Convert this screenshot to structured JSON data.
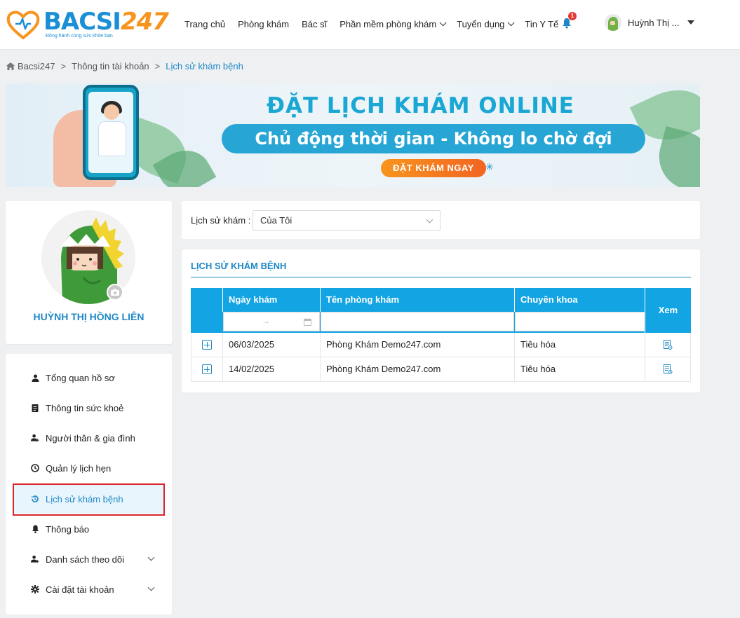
{
  "header": {
    "logo": {
      "brand_main": "BACSI",
      "brand_num": "247",
      "tagline": "Đồng hành cùng sức khỏe bạn"
    },
    "nav": [
      {
        "label": "Trang chủ",
        "dropdown": false
      },
      {
        "label": "Phòng khám",
        "dropdown": false
      },
      {
        "label": "Bác sĩ",
        "dropdown": false
      },
      {
        "label": "Phần mềm phòng khám",
        "dropdown": true
      },
      {
        "label": "Tuyển dụng",
        "dropdown": true
      },
      {
        "label": "Tin Y Tế",
        "dropdown": false
      }
    ],
    "notification_count": "1",
    "user_name": "Huỳnh Thị ..."
  },
  "breadcrumb": [
    "Bacsi247",
    "Thông tin tài khoản",
    "Lịch sử khám bệnh"
  ],
  "banner": {
    "title": "ĐẶT LỊCH KHÁM ONLINE",
    "subtitle": "Chủ động thời gian - Không lo chờ đợi",
    "cta": "ĐẶT KHÁM NGAY"
  },
  "profile": {
    "name": "HUỲNH THỊ HỒNG LIÊN"
  },
  "menu": [
    {
      "label": "Tổng quan hồ sơ",
      "icon": "user-icon"
    },
    {
      "label": "Thông tin sức khoẻ",
      "icon": "clipboard-icon"
    },
    {
      "label": "Người thân & gia đình",
      "icon": "user-plus-icon"
    },
    {
      "label": "Quản lý lịch hẹn",
      "icon": "clock-icon"
    },
    {
      "label": "Lịch sử khám bệnh",
      "icon": "history-icon",
      "active": true
    },
    {
      "label": "Thông báo",
      "icon": "bell-icon"
    },
    {
      "label": "Danh sách theo dõi",
      "icon": "user-follow-icon",
      "expandable": true
    },
    {
      "label": "Cài đặt tài khoản",
      "icon": "gear-icon",
      "expandable": true
    }
  ],
  "filter": {
    "label": "Lịch sử khám",
    "selected": "Của Tôi"
  },
  "history": {
    "title": "LỊCH SỬ KHÁM BỆNH",
    "columns": [
      "Ngày khám",
      "Tên phòng khám",
      "Chuyên khoa",
      "Xem"
    ],
    "date_range_separator": "→",
    "rows": [
      {
        "date": "06/03/2025",
        "clinic": "Phòng Khám Demo247.com",
        "specialty": "Tiêu hóa"
      },
      {
        "date": "14/02/2025",
        "clinic": "Phòng Khám Demo247.com",
        "specialty": "Tiêu hóa"
      }
    ]
  },
  "colors": {
    "primary": "#1e88c7",
    "table_header": "#12a4e3",
    "accent": "#f7941d",
    "highlight_border": "#d9252a"
  }
}
